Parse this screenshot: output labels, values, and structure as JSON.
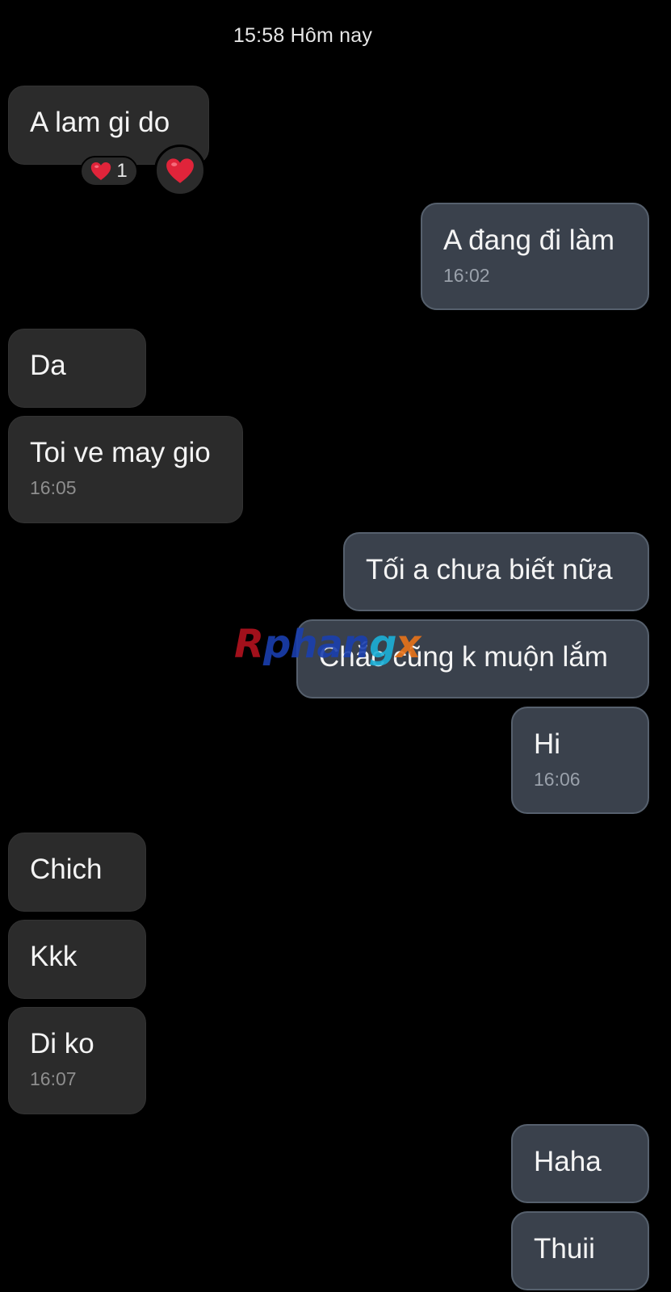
{
  "header": {
    "timestamp": "15:58 Hôm nay"
  },
  "messages": [
    {
      "side": "incoming",
      "text": "A lam gi do",
      "time": ""
    },
    {
      "side": "outgoing",
      "text": "A đang đi làm",
      "time": "16:02"
    },
    {
      "side": "incoming",
      "text": "Da",
      "time": ""
    },
    {
      "side": "incoming",
      "text": "Toi ve may gio",
      "time": "16:05"
    },
    {
      "side": "outgoing",
      "text": "Tối a chưa biết nữa",
      "time": ""
    },
    {
      "side": "outgoing",
      "text": "Chắc cũng k muộn lắm",
      "time": ""
    },
    {
      "side": "outgoing",
      "text": "Hi",
      "time": "16:06"
    },
    {
      "side": "incoming",
      "text": "Chich",
      "time": ""
    },
    {
      "side": "incoming",
      "text": "Kkk",
      "time": ""
    },
    {
      "side": "incoming",
      "text": "Di ko",
      "time": "16:07"
    },
    {
      "side": "outgoing",
      "text": "Haha",
      "time": ""
    },
    {
      "side": "outgoing",
      "text": "Thuii",
      "time": ""
    }
  ],
  "reactions": {
    "summary_icon": "heart-icon",
    "summary_count": "1",
    "action_icon": "heart-icon"
  },
  "watermark": {
    "part1": "R",
    "part2": "phan",
    "part3": "g",
    "part4": "x"
  },
  "colors": {
    "background": "#000000",
    "incoming_bubble": "#2b2b2b",
    "outgoing_bubble": "#3a414c",
    "outgoing_border": "#56606d",
    "heart": "#e0243a"
  }
}
